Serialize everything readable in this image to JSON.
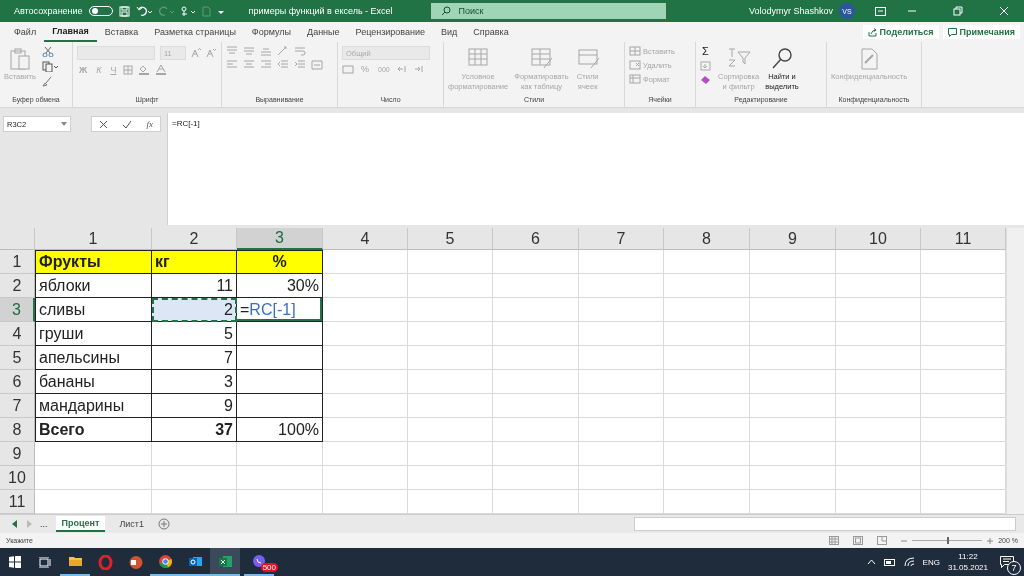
{
  "title_bar": {
    "autosave_label": "Автосохранение",
    "autosave_on": false,
    "document_title": "примеры функций в ексель  -  Excel",
    "search": {
      "placeholder": "Поиск"
    },
    "user_name": "Volodymyr Shashkov",
    "user_initials": "VS"
  },
  "ribbon_tabs": [
    {
      "label": "Файл",
      "selected": false
    },
    {
      "label": "Главная",
      "selected": true
    },
    {
      "label": "Вставка",
      "selected": false
    },
    {
      "label": "Разметка страницы",
      "selected": false
    },
    {
      "label": "Формулы",
      "selected": false
    },
    {
      "label": "Данные",
      "selected": false
    },
    {
      "label": "Рецензирование",
      "selected": false
    },
    {
      "label": "Вид",
      "selected": false
    },
    {
      "label": "Справка",
      "selected": false
    }
  ],
  "ribbon_actions": [
    {
      "kind": "share",
      "label": "Поделиться"
    },
    {
      "kind": "comments",
      "label": "Примечания"
    }
  ],
  "ribbon_groups": [
    {
      "kind": "clipboard",
      "title": "Буфер обмена",
      "paste": {
        "label": "Вставить",
        "disabled": true
      }
    },
    {
      "kind": "font",
      "title": "Шрифт",
      "disabled": true,
      "font_size": "11",
      "bold": "Ж",
      "italic": "К",
      "underline": "Ч"
    },
    {
      "kind": "alignment",
      "title": "Выравнивание",
      "disabled": true
    },
    {
      "kind": "number",
      "title": "Число",
      "disabled": true,
      "format": "Общий",
      "percent": "%",
      "thousands": "000"
    },
    {
      "kind": "styles",
      "title": "Стили",
      "buttons": [
        {
          "lines": [
            "Условное",
            "форматирование"
          ],
          "disabled": true
        },
        {
          "lines": [
            "Форматировать",
            "как таблицу"
          ],
          "disabled": true
        },
        {
          "lines": [
            "Стили",
            "ячеек"
          ],
          "disabled": true
        }
      ]
    },
    {
      "kind": "cells",
      "title": "Ячейки",
      "buttons": [
        {
          "label": "Вставить",
          "disabled": true
        },
        {
          "label": "Удалить",
          "disabled": true
        },
        {
          "label": "Формат",
          "disabled": true
        }
      ]
    },
    {
      "kind": "editing",
      "title": "Редактирование",
      "sum": "Σ",
      "buttons": [
        {
          "lines": [
            "Сортировка",
            "и фильтр"
          ],
          "disabled": true
        },
        {
          "lines": [
            "Найти и",
            "выделить"
          ],
          "disabled": false
        }
      ]
    },
    {
      "kind": "sensitivity",
      "title": "Конфиденциальность",
      "buttons": [
        {
          "lines": [
            "Конфиденциальность"
          ],
          "disabled": true
        }
      ]
    }
  ],
  "formula_bar": {
    "name_box": "R3C2",
    "function_label": "fx",
    "formula": "=RC[-1]"
  },
  "sheet": {
    "columns": [
      {
        "label": "1",
        "selected": false
      },
      {
        "label": "2",
        "selected": false
      },
      {
        "label": "3",
        "selected": true
      },
      {
        "label": "4",
        "selected": false
      },
      {
        "label": "5",
        "selected": false
      },
      {
        "label": "6",
        "selected": false
      },
      {
        "label": "7",
        "selected": false
      },
      {
        "label": "8",
        "selected": false
      },
      {
        "label": "9",
        "selected": false
      },
      {
        "label": "10",
        "selected": false
      },
      {
        "label": "11",
        "selected": false
      }
    ],
    "rows": [
      {
        "label": "1",
        "selected": false,
        "cells": [
          {
            "text": "Фрукты",
            "bold": true,
            "highlighted": true,
            "bordered": true
          },
          {
            "text": "кг",
            "bold": true,
            "highlighted": true,
            "bordered": true
          },
          {
            "text": "%",
            "centered": true,
            "bold": true,
            "highlighted": true,
            "bordered": true
          }
        ]
      },
      {
        "label": "2",
        "selected": false,
        "cells": [
          {
            "text": "яблоки",
            "bordered": true
          },
          {
            "text": "11",
            "right_aligned": true,
            "bordered": true
          },
          {
            "text": "30%",
            "right_aligned": true,
            "bordered": true
          }
        ]
      },
      {
        "label": "3",
        "selected": true,
        "cells": [
          {
            "text": "сливы",
            "bordered": true
          },
          {
            "text": "2",
            "right_aligned": true,
            "bordered": true,
            "copy_source": true
          },
          {
            "kind": "editing",
            "prefix": "=",
            "reference": "RC[-1]",
            "bordered": true
          }
        ]
      },
      {
        "label": "4",
        "selected": false,
        "cells": [
          {
            "text": "груши",
            "bordered": true
          },
          {
            "text": "5",
            "right_aligned": true,
            "bordered": true
          },
          {
            "bordered": true
          }
        ]
      },
      {
        "label": "5",
        "selected": false,
        "cells": [
          {
            "text": "апельсины",
            "bordered": true
          },
          {
            "text": "7",
            "right_aligned": true,
            "bordered": true
          },
          {
            "bordered": true
          }
        ]
      },
      {
        "label": "6",
        "selected": false,
        "cells": [
          {
            "text": "бананы",
            "bordered": true
          },
          {
            "text": "3",
            "right_aligned": true,
            "bordered": true
          },
          {
            "bordered": true
          }
        ]
      },
      {
        "label": "7",
        "selected": false,
        "cells": [
          {
            "text": "мандарины",
            "bordered": true
          },
          {
            "text": "9",
            "right_aligned": true,
            "bordered": true
          },
          {
            "bordered": true
          }
        ]
      },
      {
        "label": "8",
        "selected": false,
        "cells": [
          {
            "text": "Всего",
            "bold": true,
            "bordered": true
          },
          {
            "text": "37",
            "right_aligned": true,
            "bold": true,
            "bordered": true
          },
          {
            "text": "100%",
            "right_aligned": true,
            "bordered": true
          }
        ]
      },
      {
        "label": "9",
        "selected": false,
        "cells": []
      },
      {
        "label": "10",
        "selected": false,
        "cells": []
      },
      {
        "label": "11",
        "selected": false,
        "cells": []
      }
    ]
  },
  "sheet_tabs": {
    "more": "...",
    "tabs": [
      {
        "label": "Процент",
        "selected": true
      },
      {
        "label": "Лист1",
        "selected": false
      }
    ]
  },
  "status_bar": {
    "mode": "Укажите",
    "zoom": {
      "level": 0.5,
      "reading": "200 %"
    }
  },
  "taskbar": {
    "apps": [
      {
        "kind": "explorer",
        "running": true,
        "active": false
      },
      {
        "kind": "opera",
        "running": false,
        "active": false
      },
      {
        "kind": "powerpoint",
        "running": false,
        "active": false
      },
      {
        "kind": "chrome",
        "running": true,
        "active": false
      },
      {
        "kind": "outlook",
        "running": true,
        "active": false
      },
      {
        "kind": "excel",
        "running": true,
        "active": true
      },
      {
        "kind": "viber",
        "running": true,
        "active": false,
        "badge": "500"
      }
    ],
    "language": "ENG",
    "time": "11:22",
    "date": "31.05.2021",
    "notifications": "7"
  }
}
